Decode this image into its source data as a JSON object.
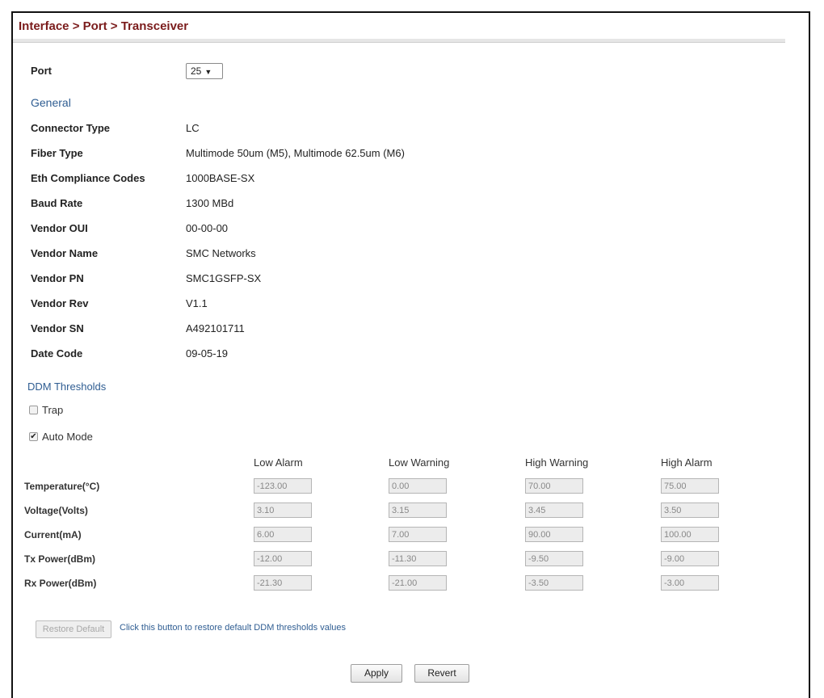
{
  "breadcrumb": "Interface > Port > Transceiver",
  "port": {
    "label": "Port",
    "value": "25"
  },
  "general": {
    "title": "General",
    "fields": [
      {
        "label": "Connector Type",
        "value": "LC"
      },
      {
        "label": "Fiber Type",
        "value": "Multimode 50um (M5), Multimode 62.5um (M6)"
      },
      {
        "label": "Eth Compliance Codes",
        "value": "1000BASE-SX"
      },
      {
        "label": "Baud Rate",
        "value": "1300 MBd"
      },
      {
        "label": "Vendor OUI",
        "value": "00-00-00"
      },
      {
        "label": "Vendor Name",
        "value": "SMC Networks"
      },
      {
        "label": "Vendor PN",
        "value": "SMC1GSFP-SX"
      },
      {
        "label": "Vendor Rev",
        "value": "V1.1"
      },
      {
        "label": "Vendor SN",
        "value": "A492101711"
      },
      {
        "label": "Date Code",
        "value": "09-05-19"
      }
    ]
  },
  "ddm": {
    "title": "DDM Thresholds",
    "trap": {
      "label": "Trap",
      "checked": false
    },
    "auto_mode": {
      "label": "Auto Mode",
      "checked": true
    },
    "columns": [
      "Low Alarm",
      "Low Warning",
      "High Warning",
      "High Alarm"
    ],
    "rows": [
      {
        "label": "Temperature(°C)",
        "values": [
          "-123.00",
          "0.00",
          "70.00",
          "75.00"
        ]
      },
      {
        "label": "Voltage(Volts)",
        "values": [
          "3.10",
          "3.15",
          "3.45",
          "3.50"
        ]
      },
      {
        "label": "Current(mA)",
        "values": [
          "6.00",
          "7.00",
          "90.00",
          "100.00"
        ]
      },
      {
        "label": "Tx Power(dBm)",
        "values": [
          "-12.00",
          "-11.30",
          "-9.50",
          "-9.00"
        ]
      },
      {
        "label": "Rx Power(dBm)",
        "values": [
          "-21.30",
          "-21.00",
          "-3.50",
          "-3.00"
        ]
      }
    ]
  },
  "restore": {
    "button": "Restore Default",
    "hint": "Click this button to restore default DDM thresholds values"
  },
  "actions": {
    "apply": "Apply",
    "revert": "Revert"
  }
}
